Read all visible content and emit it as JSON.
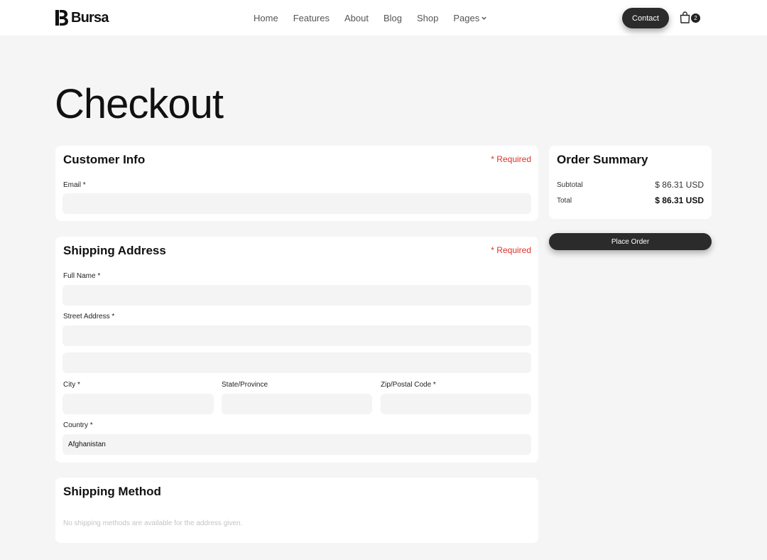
{
  "header": {
    "brand": "Bursa",
    "nav": [
      "Home",
      "Features",
      "About",
      "Blog",
      "Shop"
    ],
    "pages_label": "Pages",
    "contact_label": "Contact",
    "cart_count": "2"
  },
  "page_title": "Checkout",
  "customer_info": {
    "title": "Customer Info",
    "required": "* Required",
    "email_label": "Email *",
    "email_value": ""
  },
  "shipping_address": {
    "title": "Shipping Address",
    "required": "* Required",
    "full_name_label": "Full Name *",
    "street_label": "Street Address *",
    "city_label": "City *",
    "state_label": "State/Province",
    "zip_label": "Zip/Postal Code *",
    "country_label": "Country *",
    "country_value": "Afghanistan"
  },
  "shipping_method": {
    "title": "Shipping Method",
    "message": "No shipping methods are available for the address given."
  },
  "order_summary": {
    "title": "Order Summary",
    "subtotal_label": "Subtotal",
    "subtotal_value": "$ 86.31 USD",
    "total_label": "Total",
    "total_value": "$ 86.31 USD",
    "place_order_label": "Place Order"
  }
}
